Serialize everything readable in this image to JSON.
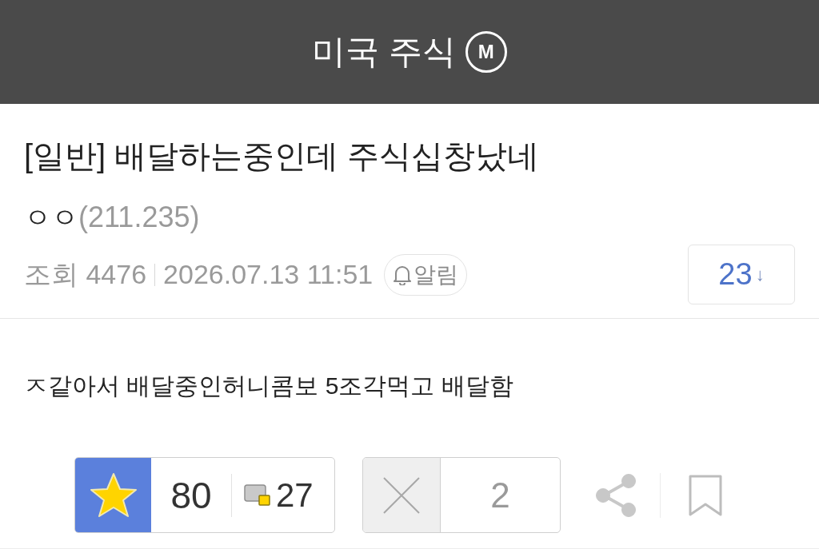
{
  "header": {
    "title": "미국 주식",
    "badge": "M"
  },
  "post": {
    "title": "[일반] 배달하는중인데 주식십창났네",
    "author": {
      "name": "ㅇㅇ",
      "ip": "(211.235)"
    },
    "views": "조회 4476",
    "datetime": "2026.07.13 11:51",
    "alert_button": "알림",
    "comments": {
      "count": "23",
      "arrow": "↓"
    }
  },
  "body": "ㅈ같아서 배달중인허니콤보 5조각먹고 배달함",
  "actions": {
    "recommend": {
      "count": "80",
      "fixed_count": "27"
    },
    "dislike": {
      "count": "2"
    }
  }
}
